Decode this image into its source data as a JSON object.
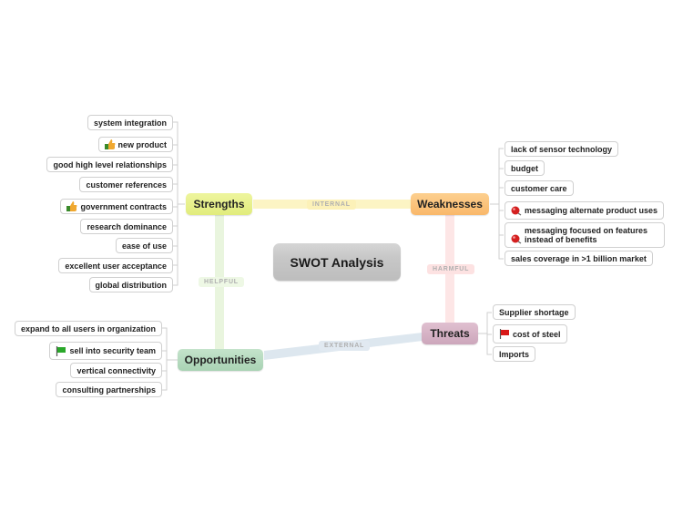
{
  "center": {
    "title": "SWOT Analysis"
  },
  "quadrants": {
    "strengths": {
      "label": "Strengths",
      "color": "#e7f08a",
      "items": [
        {
          "text": "system integration",
          "icon": null
        },
        {
          "text": "new product",
          "icon": "thumbs-up-icon"
        },
        {
          "text": "good high level relationships",
          "icon": null
        },
        {
          "text": "customer references",
          "icon": null
        },
        {
          "text": "government contracts",
          "icon": "thumbs-up-icon"
        },
        {
          "text": "research dominance",
          "icon": null
        },
        {
          "text": "ease of use",
          "icon": null
        },
        {
          "text": "excellent user acceptance",
          "icon": null
        },
        {
          "text": "global distribution",
          "icon": null
        }
      ]
    },
    "weaknesses": {
      "label": "Weaknesses",
      "color": "#fbc37c",
      "items": [
        {
          "text": "lack of sensor technology",
          "icon": null
        },
        {
          "text": "budget",
          "icon": null
        },
        {
          "text": "customer care",
          "icon": null
        },
        {
          "text": "messaging alternate product uses",
          "icon": "red-pin-icon"
        },
        {
          "text": "messaging focused on features instead of benefits",
          "icon": "red-pin-icon"
        },
        {
          "text": "sales coverage in >1 billion market",
          "icon": null
        }
      ]
    },
    "opportunities": {
      "label": "Opportunities",
      "color": "#b3d9bd",
      "items": [
        {
          "text": "expand to all users in organization",
          "icon": null
        },
        {
          "text": "sell into security team",
          "icon": "green-flag-icon"
        },
        {
          "text": "vertical connectivity",
          "icon": null
        },
        {
          "text": "consulting partnerships",
          "icon": null
        }
      ]
    },
    "threats": {
      "label": "Threats",
      "color": "#d6b3c6",
      "items": [
        {
          "text": "Supplier shortage",
          "icon": null
        },
        {
          "text": "cost of steel",
          "icon": "red-flag-icon"
        },
        {
          "text": "Imports",
          "icon": null
        }
      ]
    }
  },
  "relations": {
    "internal": "INTERNAL",
    "harmful": "HARMFUL",
    "helpful": "HELPFUL",
    "external": "EXTERNAL"
  }
}
